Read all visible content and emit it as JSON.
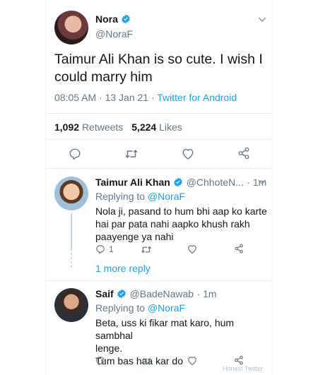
{
  "main_tweet": {
    "name": "Nora",
    "handle": "@NoraF",
    "text": "Taimur Ali Khan is so cute. I wish I could marry him",
    "timestamp": "08:05 AM · 13 Jan 21 · ",
    "source": "Twitter for Android",
    "retweets_count": "1,092",
    "retweets_label": "Retweets",
    "likes_count": "5,224",
    "likes_label": "Likes"
  },
  "replies": [
    {
      "name": "Taimur Ali Khan",
      "handle": "@ChhoteN...",
      "time": "· 1m",
      "replying_prefix": "Replying to ",
      "replying_handle": "@NoraF",
      "text_line1": "Nola ji, pasand to hum bhi aap ko karte",
      "text_line2": "hai par pata nahi aapko khush rakh",
      "text_line3": "paayenge ya nahi",
      "reply_count": "1",
      "more_replies": "1 more reply"
    },
    {
      "name": "Saif",
      "handle": "@BadeNawab",
      "time": "· 1m",
      "replying_prefix": "Replying to ",
      "replying_handle": "@NoraF",
      "text_line1": "Beta, uss ki fikar mat karo, hum sambhal",
      "text_line2": "lenge.",
      "text_line3": "Tum bas haa kar do"
    }
  ],
  "watermark": "Honest Twitter",
  "colors": {
    "accent": "#1da1f2",
    "text": "#14171a",
    "muted": "#657786",
    "divider": "#e6ecf0"
  },
  "icons": [
    "verified-badge-icon",
    "chevron-down-icon",
    "reply-icon",
    "retweet-icon",
    "like-icon",
    "share-icon"
  ]
}
